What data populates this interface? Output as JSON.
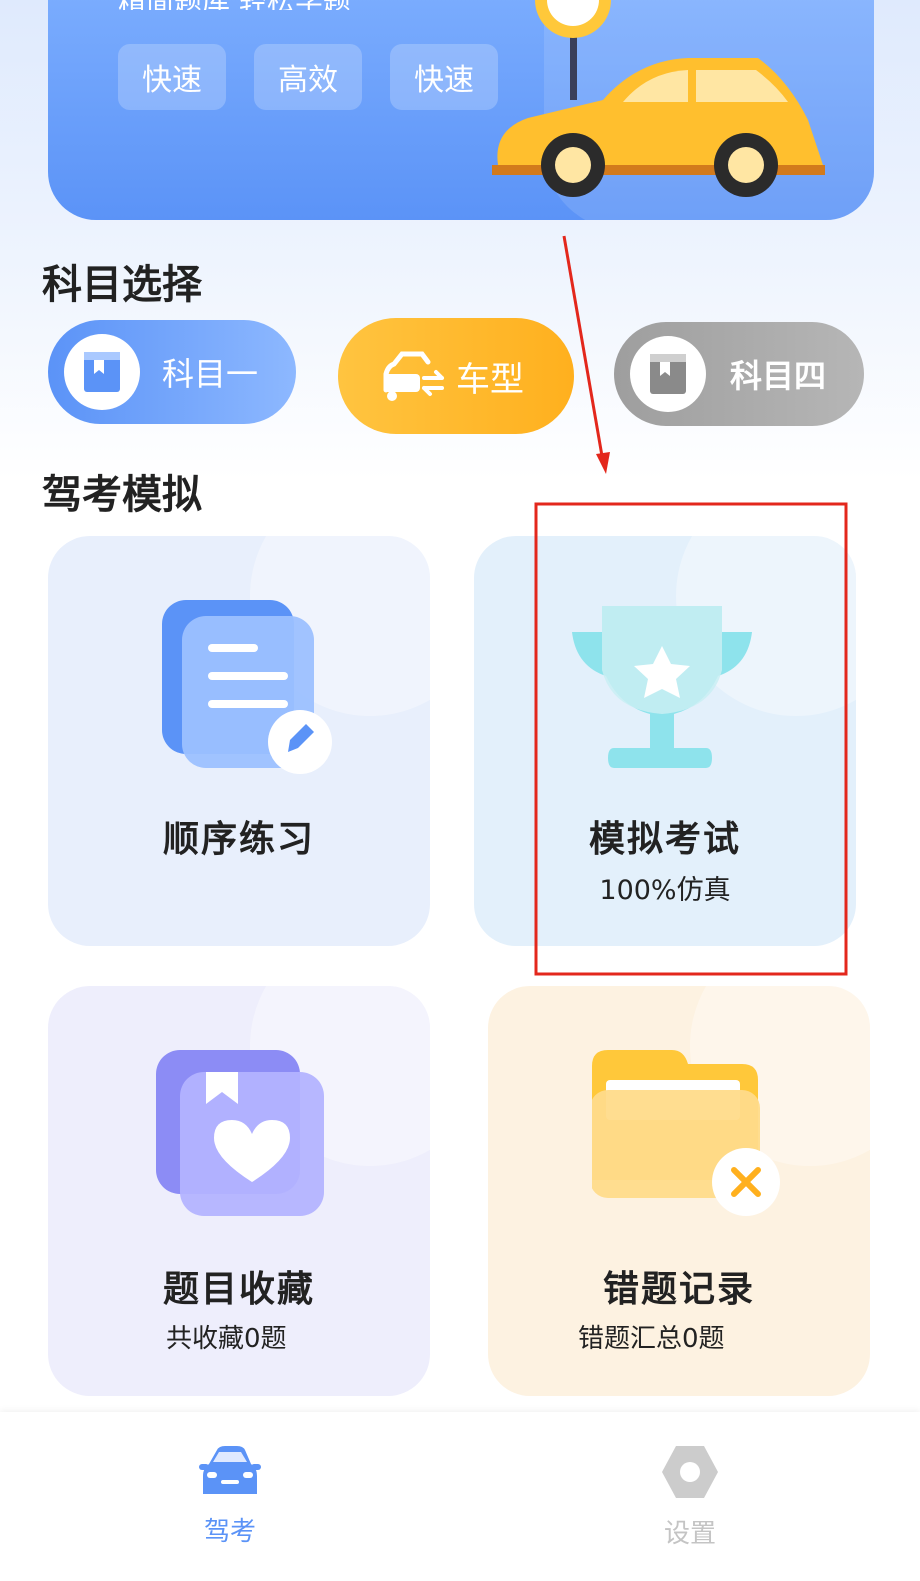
{
  "banner": {
    "subtitle": "精简题库 轻松学题",
    "chips": [
      "快速",
      "高效",
      "快速"
    ]
  },
  "subjects": {
    "title": "科目选择",
    "items": [
      {
        "label": "科目一"
      },
      {
        "label": "车型"
      },
      {
        "label": "科目四"
      }
    ]
  },
  "simulation": {
    "title": "驾考模拟",
    "cards": [
      {
        "title": "顺序练习",
        "subtitle": ""
      },
      {
        "title": "模拟考试",
        "subtitle": "100%仿真"
      },
      {
        "title": "题目收藏",
        "subtitle": "共收藏0题"
      },
      {
        "title": "错题记录",
        "subtitle": "错题汇总0题"
      }
    ]
  },
  "tabbar": {
    "items": [
      {
        "label": "驾考",
        "active": true
      },
      {
        "label": "设置",
        "active": false
      }
    ]
  },
  "colors": {
    "primary": "#5b93f7",
    "orange": "#ffb01e",
    "gray": "#9e9e9e",
    "annotation": "#e3271c"
  }
}
